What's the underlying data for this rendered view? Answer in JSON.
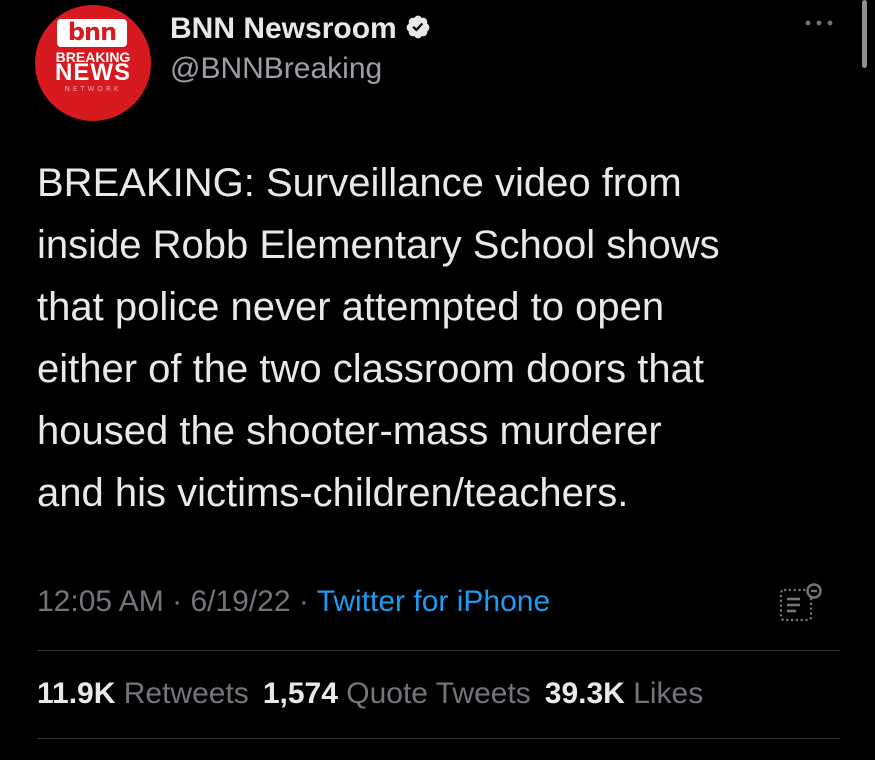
{
  "account": {
    "display_name": "BNN Newsroom",
    "handle": "@BNNBreaking",
    "avatar": {
      "logo_text": "bnn",
      "line1": "BREAKING",
      "line2": "NEWS",
      "line3": "NETWORK",
      "brand_color": "#d71920"
    },
    "verified": true
  },
  "tweet": {
    "text": "BREAKING: Surveillance video from\ninside Robb Elementary School shows\nthat police never attempted to open\neither of the two classroom doors that\nhoused the shooter-mass murderer\nand his victims-children/teachers.",
    "time": "12:05 AM",
    "separator": "·",
    "date": "6/19/22",
    "source": "Twitter for iPhone"
  },
  "stats": {
    "retweets_count": "11.9K",
    "retweets_label": "Retweets",
    "quotes_count": "1,574",
    "quotes_label": "Quote Tweets",
    "likes_count": "39.3K",
    "likes_label": "Likes"
  },
  "icons": {
    "verified": "verified-badge-icon",
    "more": "more-options-icon",
    "analytics": "tweet-analytics-icon"
  },
  "colors": {
    "background": "#000000",
    "text": "#e7e9ea",
    "secondary_text": "#72767b",
    "link": "#1d9bf0",
    "divider": "#2f3336"
  }
}
